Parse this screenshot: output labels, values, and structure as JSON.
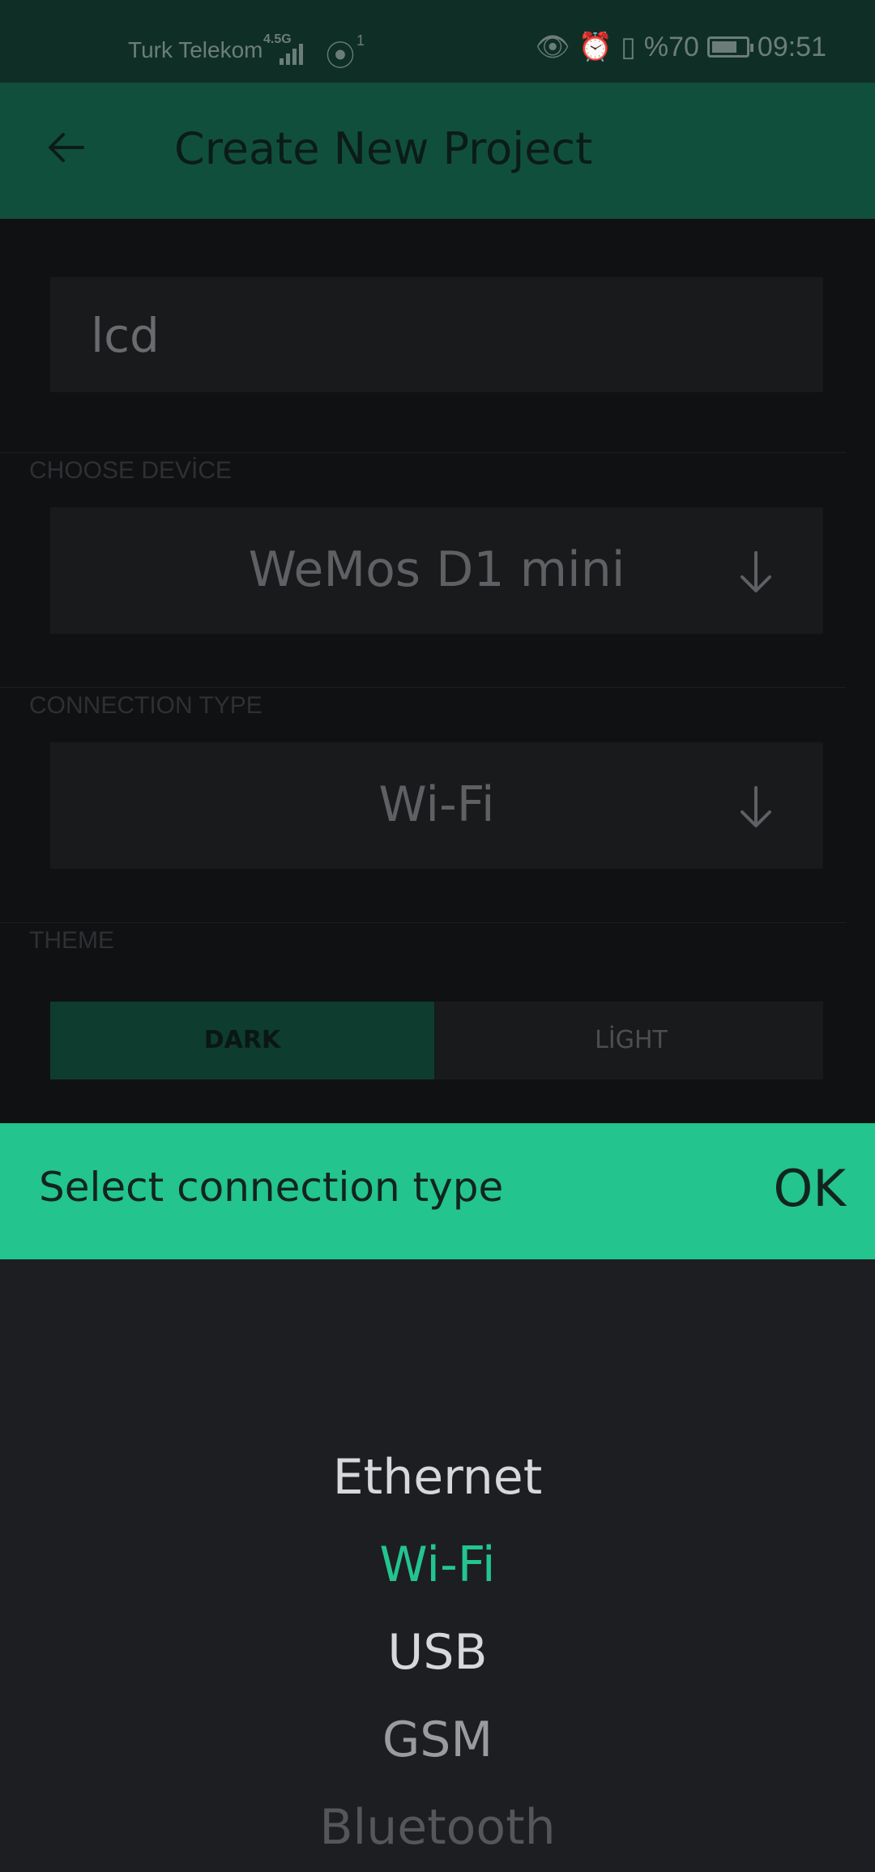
{
  "status_bar": {
    "carrier": "Turk Telekom",
    "network": "4.5G",
    "hotspot_count": "1",
    "battery": "%70",
    "time": "09:51"
  },
  "app_bar": {
    "title": "Create New Project"
  },
  "form": {
    "project_name": "lcd",
    "device_label": "CHOOSE DEVİCE",
    "device_value": "WeMos D1 mini",
    "connection_label": "CONNECTION TYPE",
    "connection_value": "Wi-Fi",
    "theme_label": "THEME",
    "theme_dark": "DARK",
    "theme_light": "LİGHT"
  },
  "sheet": {
    "title": "Select connection type",
    "ok_label": "OK",
    "options": [
      {
        "label": "Ethernet",
        "color": "#d7d8da"
      },
      {
        "label": "Wi-Fi",
        "color": "#23c48e",
        "selected": true
      },
      {
        "label": "USB",
        "color": "#d7d8da"
      },
      {
        "label": "GSM",
        "color": "#9a9b9e"
      },
      {
        "label": "Bluetooth",
        "color": "#54565a"
      }
    ]
  },
  "colors": {
    "accent": "#23c48e",
    "app_bar": "#114f3d",
    "status_bar": "#0f2f26"
  }
}
